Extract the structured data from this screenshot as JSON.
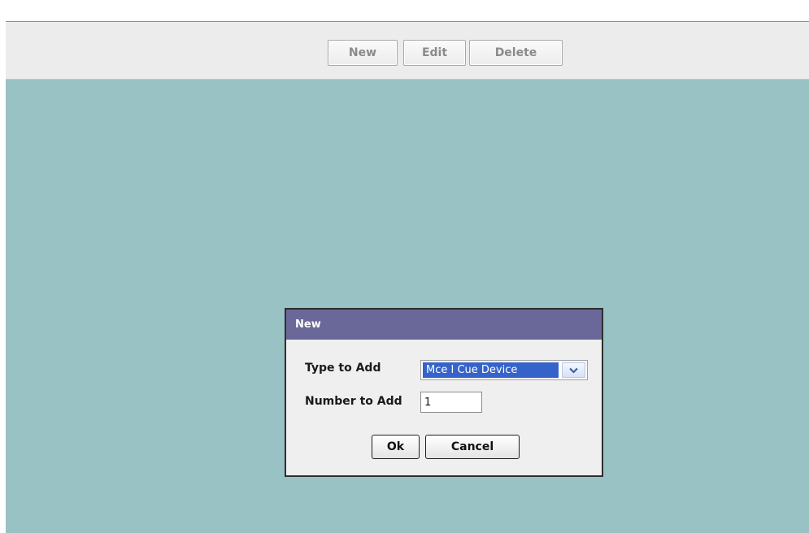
{
  "toolbar": {
    "new_label": "New",
    "edit_label": "Edit",
    "delete_label": "Delete"
  },
  "dialog": {
    "title": "New",
    "type_label": "Type to Add",
    "type_selected": "Mce I Cue Device",
    "number_label": "Number to Add",
    "number_value": "1",
    "ok_label": "Ok",
    "cancel_label": "Cancel"
  },
  "icons": {
    "select_arrow": "chevron-down-icon"
  },
  "colors": {
    "workspace_bg": "#98c2c3",
    "dialog_title_bg": "#6a6799",
    "selected_option_bg": "#3663c9",
    "toolbar_bg": "#ececec"
  }
}
